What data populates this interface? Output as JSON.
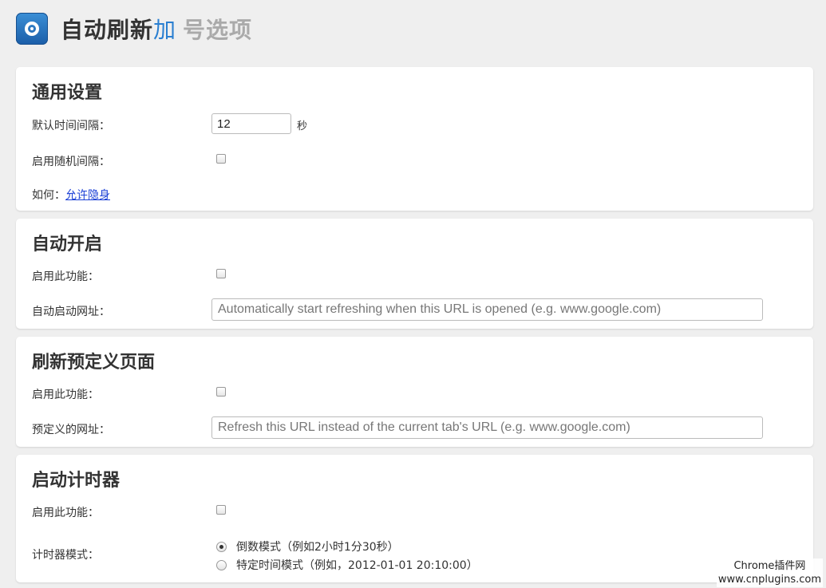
{
  "header": {
    "title_part1": "自动刷新",
    "title_part2": "加",
    "title_part3": "号选项"
  },
  "general": {
    "heading": "通用设置",
    "interval_label": "默认时间间隔：",
    "interval_value": "12",
    "interval_unit": "秒",
    "random_label": "启用随机间隔：",
    "random_checked": false,
    "howto_label": "如何：",
    "howto_link": "允许隐身"
  },
  "autostart": {
    "heading": "自动开启",
    "enable_label": "启用此功能：",
    "enable_checked": false,
    "url_label": "自动启动网址：",
    "url_placeholder": "Automatically start refreshing when this URL is opened (e.g. www.google.com)"
  },
  "predefined": {
    "heading": "刷新预定义页面",
    "enable_label": "启用此功能：",
    "enable_checked": false,
    "url_label": "预定义的网址：",
    "url_placeholder": "Refresh this URL instead of the current tab's URL (e.g. www.google.com)"
  },
  "timer": {
    "heading": "启动计时器",
    "enable_label": "启用此功能：",
    "enable_checked": false,
    "mode_label": "计时器模式：",
    "mode_options": [
      {
        "label": "倒数模式（例如2小时1分30秒）",
        "checked": true
      },
      {
        "label": "特定时间模式（例如，2012-01-01 20:10:00）",
        "checked": false
      }
    ]
  },
  "watermark": {
    "line1": "Chrome插件网",
    "line2": "www.cnplugins.com"
  }
}
